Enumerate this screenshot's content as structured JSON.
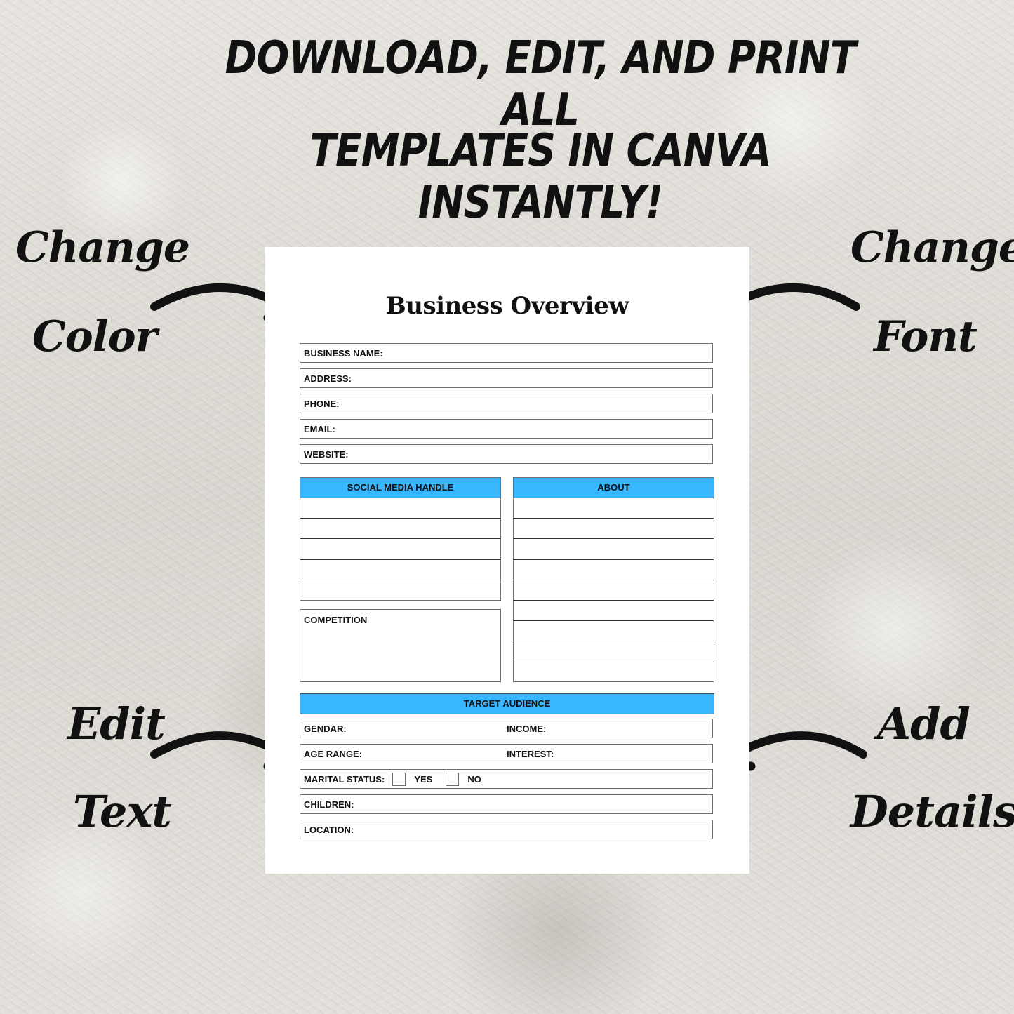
{
  "headline": {
    "line1": "DOWNLOAD, EDIT, AND PRINT ALL",
    "line2": "TEMPLATES IN CANVA INSTANTLY!"
  },
  "callouts": {
    "change_color": [
      "Change",
      "Color"
    ],
    "change_font": [
      "Change",
      "Font"
    ],
    "edit_text": [
      "Edit",
      "Text"
    ],
    "add_details": [
      "Add",
      "Details"
    ]
  },
  "template": {
    "title": "Business Overview",
    "accent_color": "#38b6ff",
    "contact_fields": [
      "BUSINESS NAME:",
      "ADDRESS:",
      "PHONE:",
      "EMAIL:",
      "WEBSITE:"
    ],
    "social_media": {
      "heading": "SOCIAL MEDIA HANDLE",
      "rows": 5
    },
    "about": {
      "heading": "ABOUT",
      "rows": 9
    },
    "competition": {
      "label": "COMPETITION"
    },
    "target_audience": {
      "heading": "TARGET AUDIENCE",
      "gender": "GENDAR:",
      "income": "INCOME:",
      "age_range": "AGE RANGE:",
      "interest": "INTEREST:",
      "marital_status": "MARITAL STATUS:",
      "yes": "YES",
      "no": "NO",
      "children": "CHILDREN:",
      "location": "LOCATION:"
    }
  }
}
